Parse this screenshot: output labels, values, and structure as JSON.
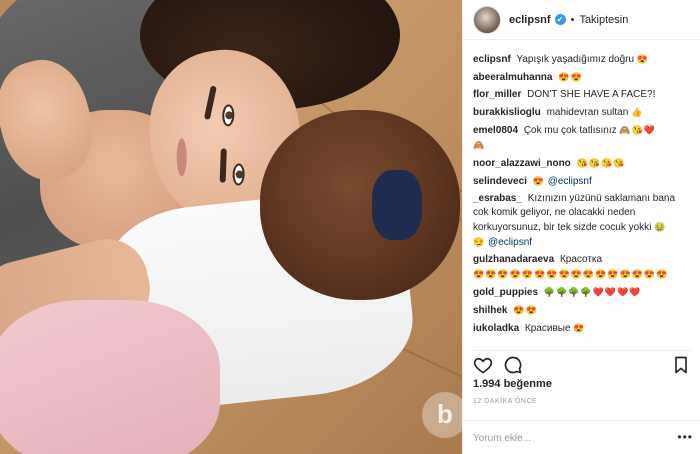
{
  "post": {
    "watermark_letter": "b"
  },
  "header": {
    "username": "eclipsnf",
    "verified_icon": "✔",
    "separator": "•",
    "follow_status": "Takiptesin"
  },
  "comments": [
    {
      "user": "eclipsnf",
      "text": "Yapışık yaşadığımız doğru",
      "emoji": "😍"
    },
    {
      "user": "abeeralmuhanna",
      "text": "",
      "emoji": "😍😍"
    },
    {
      "user": "flor_miller",
      "text": "DON'T SHE HAVE A FACE?!",
      "emoji": ""
    },
    {
      "user": "burakkislioglu",
      "text": "mahidevran sultan",
      "emoji": "👍"
    },
    {
      "user": "emel0804",
      "text": "Çok mu çok tatlısınız",
      "emoji": "🙈😘❤️"
    },
    {
      "user": "",
      "text": "",
      "emoji": "🙈"
    },
    {
      "user": "noor_alazzawi_nono",
      "text": "",
      "emoji": "😘😘😘😘"
    },
    {
      "user": "selindeveci",
      "text": "",
      "emoji": "😍",
      "mention": "@eclipsnf"
    },
    {
      "user": "_esrabas_",
      "text": "Kızınızın yüzünü saklamanı bana cok komik geliyor, ne olacakki neden korkuyorsunuz, bir tek sizde cocuk yokki",
      "emoji": "🤢",
      "mention": "@eclipsnf",
      "lead_emoji": "😏"
    },
    {
      "user": "gulzhanadaraeva",
      "text": "Красотка",
      "emoji": "😍😍😍😍😍😍😍😍😍😍😍😍😍😍😍😍"
    },
    {
      "user": "gold_puppies",
      "text": "",
      "emoji": "🌳🌳🌳🌳❤️❤️❤️❤️"
    },
    {
      "user": "shilhek",
      "text": "",
      "emoji": "😍😍"
    },
    {
      "user": "iukoladka",
      "text": "Красивые",
      "emoji": "😍"
    }
  ],
  "actions": {
    "like_icon": "heart-icon",
    "comment_icon": "comment-icon",
    "save_icon": "bookmark-icon"
  },
  "likes": "1.994 beğenme",
  "timestamp": "12 DAKİKA ÖNCE",
  "comment_box": {
    "placeholder": "Yorum ekle...",
    "more": "•••"
  }
}
